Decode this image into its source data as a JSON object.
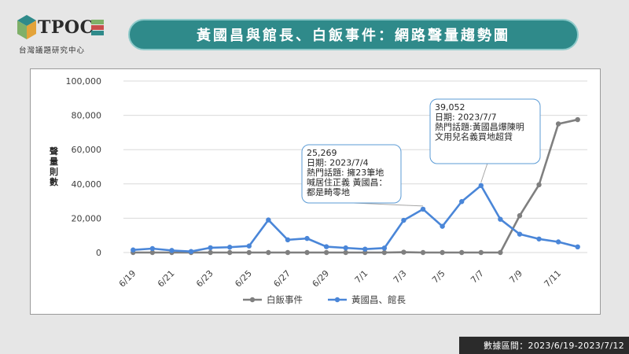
{
  "logo": {
    "text": "TPOC",
    "subtitle": "台灣議題研究中心",
    "colors": [
      "#2f8a8a",
      "#7fb069",
      "#e3a33a",
      "#c94c4c"
    ]
  },
  "header": {
    "title": "黃國昌與館長、白飯事件：網路聲量趨勢圖"
  },
  "footer": {
    "text": "數據區間：2023/6/19-2023/7/12"
  },
  "chart_data": {
    "type": "line",
    "title": "",
    "xlabel": "",
    "ylabel": "聲量則數",
    "ylim": [
      0,
      100000
    ],
    "yticks": [
      0,
      20000,
      40000,
      60000,
      80000,
      100000
    ],
    "ytick_labels": [
      "0",
      "20,000",
      "40,000",
      "60,000",
      "80,000",
      "100,000"
    ],
    "grid": true,
    "legend_position": "bottom",
    "categories": [
      "6/19",
      "6/20",
      "6/21",
      "6/22",
      "6/23",
      "6/24",
      "6/25",
      "6/26",
      "6/27",
      "6/28",
      "6/29",
      "6/30",
      "7/1",
      "7/2",
      "7/3",
      "7/4",
      "7/5",
      "7/6",
      "7/7",
      "7/8",
      "7/9",
      "7/10",
      "7/11",
      "7/12"
    ],
    "tick_labels": [
      "6/19",
      "6/21",
      "6/23",
      "6/25",
      "6/27",
      "6/29",
      "7/1",
      "7/3",
      "7/5",
      "7/7",
      "7/9",
      "7/11"
    ],
    "series": [
      {
        "name": "白飯事件",
        "color": "#7f7f7f",
        "values": [
          0,
          0,
          0,
          0,
          0,
          0,
          0,
          0,
          0,
          0,
          0,
          0,
          0,
          0,
          200,
          0,
          0,
          0,
          0,
          0,
          21500,
          39500,
          75000,
          77500
        ]
      },
      {
        "name": "黃國昌、館長",
        "color": "#4a86d8",
        "values": [
          1500,
          2300,
          1200,
          600,
          2800,
          3100,
          3800,
          19000,
          7400,
          8200,
          3400,
          2700,
          2000,
          2600,
          18800,
          25269,
          15300,
          29700,
          39052,
          19400,
          10700,
          7900,
          6200,
          3300
        ]
      }
    ],
    "annotations": [
      {
        "category": "7/4",
        "value_text": "25,269",
        "date_text": "日期: 2023/7/4",
        "topic_text": "熱門話題: 擁23筆地喊居住正義 黃國昌：都是畸零地"
      },
      {
        "category": "7/7",
        "value_text": "39,052",
        "date_text": "日期: 2023/7/7",
        "topic_text": "熱門話題:黃國昌爆陳明文用兒名義買地超貸"
      }
    ]
  }
}
